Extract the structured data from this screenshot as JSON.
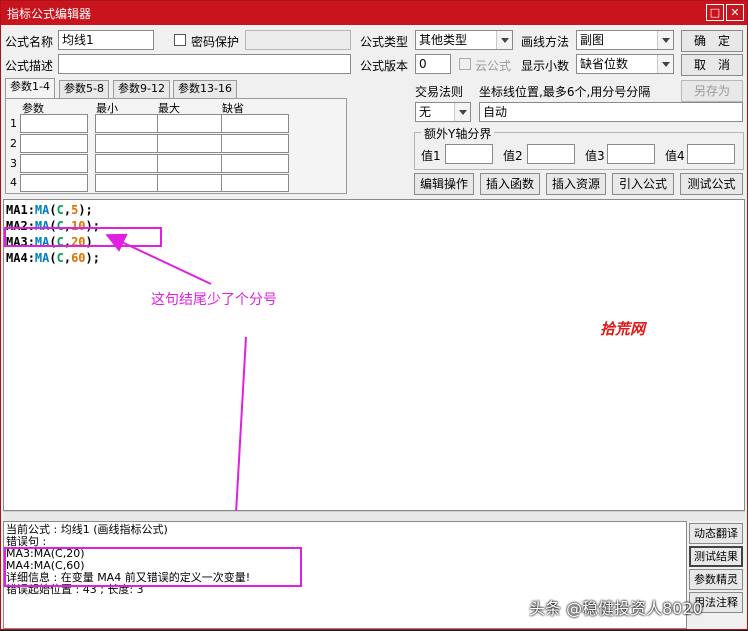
{
  "window": {
    "title": "指标公式编辑器",
    "max_icon": "□",
    "close_icon": "✕"
  },
  "form": {
    "name_label": "公式名称",
    "name_value": "均线1",
    "password_label": "密码保护",
    "desc_label": "公式描述",
    "type_label": "公式类型",
    "type_value": "其他类型",
    "draw_label": "画线方法",
    "draw_value": "副图",
    "version_label": "公式版本",
    "version_value": "0",
    "cloud_label": "云公式",
    "decimal_label": "显示小数",
    "decimal_value": "缺省位数",
    "trade_rule_label": "交易法则",
    "trade_rule_value": "无",
    "coord_label": "坐标线位置,最多6个,用分号分隔",
    "coord_value": "自动",
    "yaxis_title": "额外Y轴分界",
    "yaxis_values": [
      "值1",
      "值2",
      "值3",
      "值4"
    ]
  },
  "buttons": {
    "ok": "确　定",
    "cancel": "取　消",
    "save_as": "另存为",
    "edit_ops": "编辑操作",
    "insert_func": "插入函数",
    "insert_res": "插入资源",
    "import_formula": "引入公式",
    "test_formula": "测试公式"
  },
  "tabs": [
    "参数1-4",
    "参数5-8",
    "参数9-12",
    "参数13-16"
  ],
  "params": {
    "headers": [
      "参数",
      "最小",
      "最大",
      "缺省"
    ],
    "rows": [
      "1",
      "2",
      "3",
      "4"
    ]
  },
  "code_lines": [
    {
      "id": "MA1",
      "colon": ":",
      "fn": "MA",
      "open": "(",
      "arg": "C",
      "comma": ",",
      "num": "5",
      "close": ");"
    },
    {
      "id": "MA2",
      "colon": ":",
      "fn": "MA",
      "open": "(",
      "arg": "C",
      "comma": ",",
      "num": "10",
      "close": ");"
    },
    {
      "id": "MA3",
      "colon": ":",
      "fn": "MA",
      "open": "(",
      "arg": "C",
      "comma": ",",
      "num": "20",
      "close": ")"
    },
    {
      "id": "MA4",
      "colon": ":",
      "fn": "MA",
      "open": "(",
      "arg": "C",
      "comma": ",",
      "num": "60",
      "close": ");"
    }
  ],
  "annotation": {
    "text": "这句结尾少了个分号",
    "color": "#e020e0"
  },
  "watermark": "拾荒网",
  "output_lines": [
    "当前公式 : 均线1 (画线指标公式)",
    "错误句 :",
    "MA3:MA(C,20)",
    "MA4:MA(C,60)",
    "详细信息 : 在变量 MA4 前又错误的定义一次变量!",
    "错误起始位置 : 43 ; 长度: 3"
  ],
  "side_buttons": [
    "动态翻译",
    "测试结果",
    "参数精灵",
    "用法注释"
  ],
  "bottom_watermark": "头条 @稳健投资人8020"
}
